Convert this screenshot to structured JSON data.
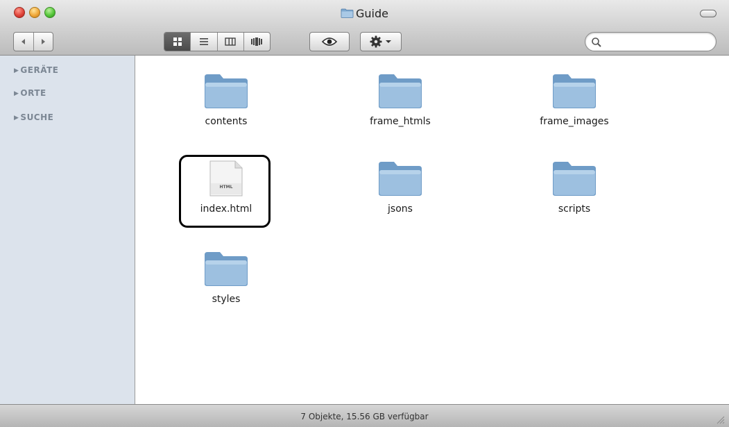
{
  "window": {
    "title": "Guide"
  },
  "sidebar": {
    "items": [
      {
        "label": "GERÄTE"
      },
      {
        "label": "ORTE"
      },
      {
        "label": "SUCHE"
      }
    ]
  },
  "search": {
    "value": ""
  },
  "files": [
    {
      "name": "contents",
      "kind": "folder"
    },
    {
      "name": "frame_htmls",
      "kind": "folder"
    },
    {
      "name": "frame_images",
      "kind": "folder"
    },
    {
      "name": "index.html",
      "kind": "html-document",
      "selected": true,
      "badge": "HTML"
    },
    {
      "name": "jsons",
      "kind": "folder"
    },
    {
      "name": "scripts",
      "kind": "folder"
    },
    {
      "name": "styles",
      "kind": "folder"
    }
  ],
  "status": {
    "text": "7 Objekte, 15.56 GB verfügbar"
  },
  "colors": {
    "folder_blue": "#8fb6d8",
    "sidebar_bg": "#dce3ec"
  }
}
